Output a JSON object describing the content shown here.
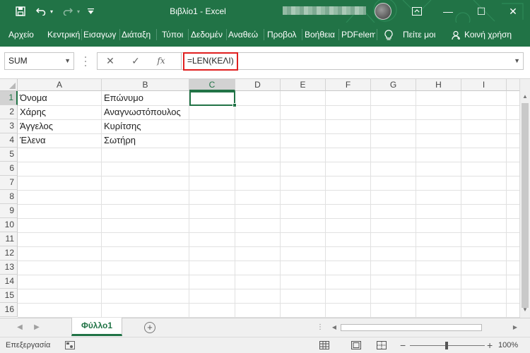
{
  "window": {
    "title": "Βιβλίο1  -  Excel",
    "save_icon": "save-icon",
    "undo_icon": "undo-icon",
    "redo_icon": "redo-icon",
    "customize_icon": "customize-qat-icon",
    "restore_icon": "ribbon-display-icon",
    "minimize_glyph": "—",
    "maximize_glyph": "☐",
    "close_glyph": "✕",
    "brand_color": "#217346"
  },
  "ribbon": {
    "tabs": [
      "Αρχείο",
      "Κεντρική",
      "Εισαγωγ",
      "Διάταξη",
      "Τύποι",
      "Δεδομέν",
      "Αναθεώ",
      "Προβολ",
      "Βοήθεια",
      "PDFelem"
    ],
    "tell_me": "Πείτε μοι",
    "share": "Κοινή χρήση"
  },
  "formula_bar": {
    "name_box": "SUM",
    "cancel_glyph": "✕",
    "enter_glyph": "✓",
    "fx_glyph": "fx",
    "formula": "=LEN(ΚΕΛΙ)",
    "highlight_color": "#e02020"
  },
  "grid": {
    "columns": [
      "A",
      "B",
      "C",
      "D",
      "E",
      "F",
      "G",
      "H",
      "I"
    ],
    "rows": [
      "1",
      "2",
      "3",
      "4",
      "5",
      "6",
      "7",
      "8",
      "9",
      "10",
      "11",
      "12",
      "13",
      "14",
      "15",
      "16"
    ],
    "selected_column": "C",
    "selected_row": "1",
    "cells": [
      [
        "Όνομα",
        "Επώνυμο"
      ],
      [
        "Χάρης",
        "Αναγνωστόπουλος"
      ],
      [
        "Άγγελος",
        "Κυρίτσης"
      ],
      [
        "Έλενα",
        "Σωτήρη"
      ]
    ]
  },
  "sheets": {
    "tabs": [
      "Φύλλο1"
    ],
    "add_glyph": "+"
  },
  "status": {
    "mode": "Επεξεργασία",
    "zoom": "100%",
    "zoom_minus": "−",
    "zoom_plus": "+"
  }
}
